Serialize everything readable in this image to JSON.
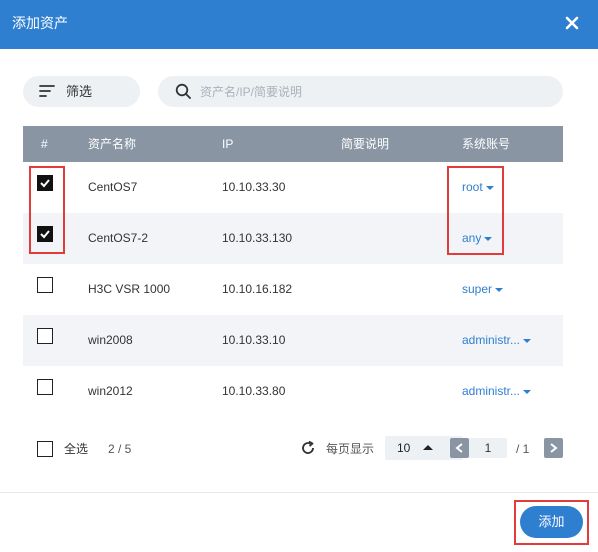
{
  "dialog": {
    "title": "添加资产",
    "close_icon": "close-icon"
  },
  "toolbar": {
    "filter_label": "筛选",
    "filter_icon": "filter-icon",
    "search_placeholder": "资产名/IP/简要说明",
    "search_value": "",
    "search_icon": "search-icon"
  },
  "table": {
    "columns": [
      "#",
      "资产名称",
      "IP",
      "简要说明",
      "系统账号"
    ],
    "rows": [
      {
        "checked": true,
        "name": "CentOS7",
        "ip": "10.10.33.30",
        "description": "",
        "account": "root"
      },
      {
        "checked": true,
        "name": "CentOS7-2",
        "ip": "10.10.33.130",
        "description": "",
        "account": "any"
      },
      {
        "checked": false,
        "name": "H3C VSR 1000",
        "ip": "10.10.16.182",
        "description": "",
        "account": "super"
      },
      {
        "checked": false,
        "name": "win2008",
        "ip": "10.10.33.10",
        "description": "",
        "account": "administr..."
      },
      {
        "checked": false,
        "name": "win2012",
        "ip": "10.10.33.80",
        "description": "",
        "account": "administr..."
      }
    ]
  },
  "footer": {
    "select_all_label": "全选",
    "select_all_checked": false,
    "selected_count": "2 / 5",
    "per_page_label": "每页显示",
    "per_page_value": "10",
    "current_page": "1",
    "total_pages": "/ 1"
  },
  "actions": {
    "add_label": "添加"
  },
  "colors": {
    "primary": "#2f7fd1",
    "table_header": "#8995a3",
    "highlight": "#e23b3b"
  }
}
